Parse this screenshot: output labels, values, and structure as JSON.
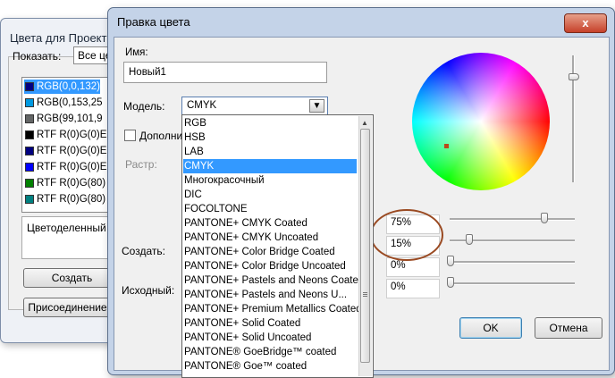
{
  "back_window": {
    "title": "Цвета для Проект",
    "show_label": "Показать:",
    "show_value": "Все це",
    "colors": [
      {
        "label": "RGB(0,0,132)",
        "color": "#000084",
        "selected": true
      },
      {
        "label": "RGB(0,153,25",
        "color": "#0099e0",
        "selected": false
      },
      {
        "label": "RGB(99,101,9",
        "color": "#636565",
        "selected": false
      },
      {
        "label": "RTF R(0)G(0)E",
        "color": "#000000",
        "selected": false
      },
      {
        "label": "RTF R(0)G(0)E",
        "color": "#000080",
        "selected": false
      },
      {
        "label": "RTF R(0)G(0)E",
        "color": "#0000ff",
        "selected": false
      },
      {
        "label": "RTF R(0)G(80)",
        "color": "#008000",
        "selected": false
      },
      {
        "label": "RTF R(0)G(80)",
        "color": "#008080",
        "selected": false
      }
    ],
    "separation_label": "Цветоделенный",
    "create_button": "Создать",
    "attach_button": "Присоединение..."
  },
  "dialog": {
    "title": "Правка цвета",
    "close_glyph": "x",
    "name_label": "Имя:",
    "name_value": "Новый1",
    "model_label": "Модель:",
    "model_value": "CMYK",
    "extra_label": "Дополни",
    "raster_label": "Растр:",
    "create_label": "Создать:",
    "source_label": "Исходный:",
    "model_options": [
      "RGB",
      "HSB",
      "LAB",
      "CMYK",
      "Многокрасочный",
      "DIC",
      "FOCOLTONE",
      "PANTONE+ CMYK Coated",
      "PANTONE+ CMYK Uncoated",
      "PANTONE+ Color Bridge Coated",
      "PANTONE+ Color Bridge Uncoated",
      "PANTONE+ Pastels and Neons Coated",
      "PANTONE+ Pastels and Neons U...",
      "PANTONE+ Premium Metallics Coated",
      "PANTONE+ Solid Coated",
      "PANTONE+ Solid Uncoated",
      "PANTONE® GoeBridge™ coated",
      "PANTONE® Goe™ coated"
    ],
    "selected_option": "CMYK",
    "channels": [
      {
        "value": "75%",
        "level": 0.75
      },
      {
        "value": "15%",
        "level": 0.15
      },
      {
        "value": "0%",
        "level": 0.0
      },
      {
        "value": "0%",
        "level": 0.0
      }
    ],
    "ok_button": "OK",
    "cancel_button": "Отмена",
    "colors": {
      "selection": "#3399ff",
      "highlight_ring": "#9a4a22",
      "dialog_frame": "#c4d3e8",
      "close_button": "#c6412a"
    }
  }
}
